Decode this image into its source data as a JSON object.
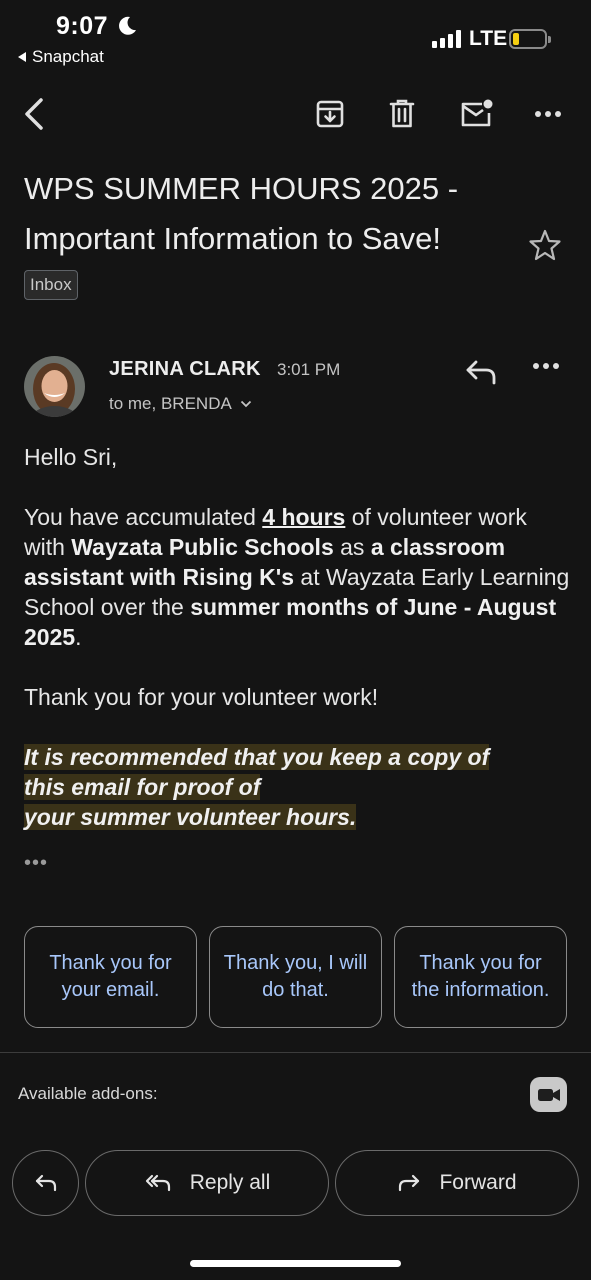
{
  "status_bar": {
    "time": "9:07",
    "back_app": "Snapchat",
    "network": "LTE",
    "battery_level": 0.15
  },
  "toolbar": {
    "icons": [
      "back-arrow-icon",
      "archive-icon",
      "trash-icon",
      "mark-unread-icon",
      "more-icon"
    ]
  },
  "email": {
    "subject": "WPS SUMMER HOURS 2025 - Important Information to Save!",
    "label": "Inbox",
    "sender": "JERINA CLARK",
    "time": "3:01 PM",
    "to_line": "to me, BRENDA",
    "greeting": "Hello Sri,",
    "p1": {
      "a": "You have accumulated ",
      "hours": "4 hours",
      "b": " of volunteer work with ",
      "org": "Wayzata Public Schools",
      "c": " as ",
      "role": "a classroom assistant with Rising K's",
      "d": " at Wayzata Early Learning School over the ",
      "period": "summer months of June - August 2025",
      "e": "."
    },
    "thanks": "Thank you for your volunteer work!",
    "highlight_1": "It is recommended that you keep a copy of",
    "highlight_2": "this email for proof of",
    "highlight_3": "your summer volunteer hours.",
    "collapsed": "•••"
  },
  "smart_replies": [
    "Thank you for your email.",
    "Thank you, I will do that.",
    "Thank you for the information."
  ],
  "addons_label": "Available add-ons:",
  "actions": {
    "reply_all": "Reply all",
    "forward": "Forward"
  },
  "colors": {
    "background": "#141414",
    "smart_reply_text": "#a8c7fa",
    "highlight": "#3a3218",
    "battery": "#f5cf12"
  }
}
